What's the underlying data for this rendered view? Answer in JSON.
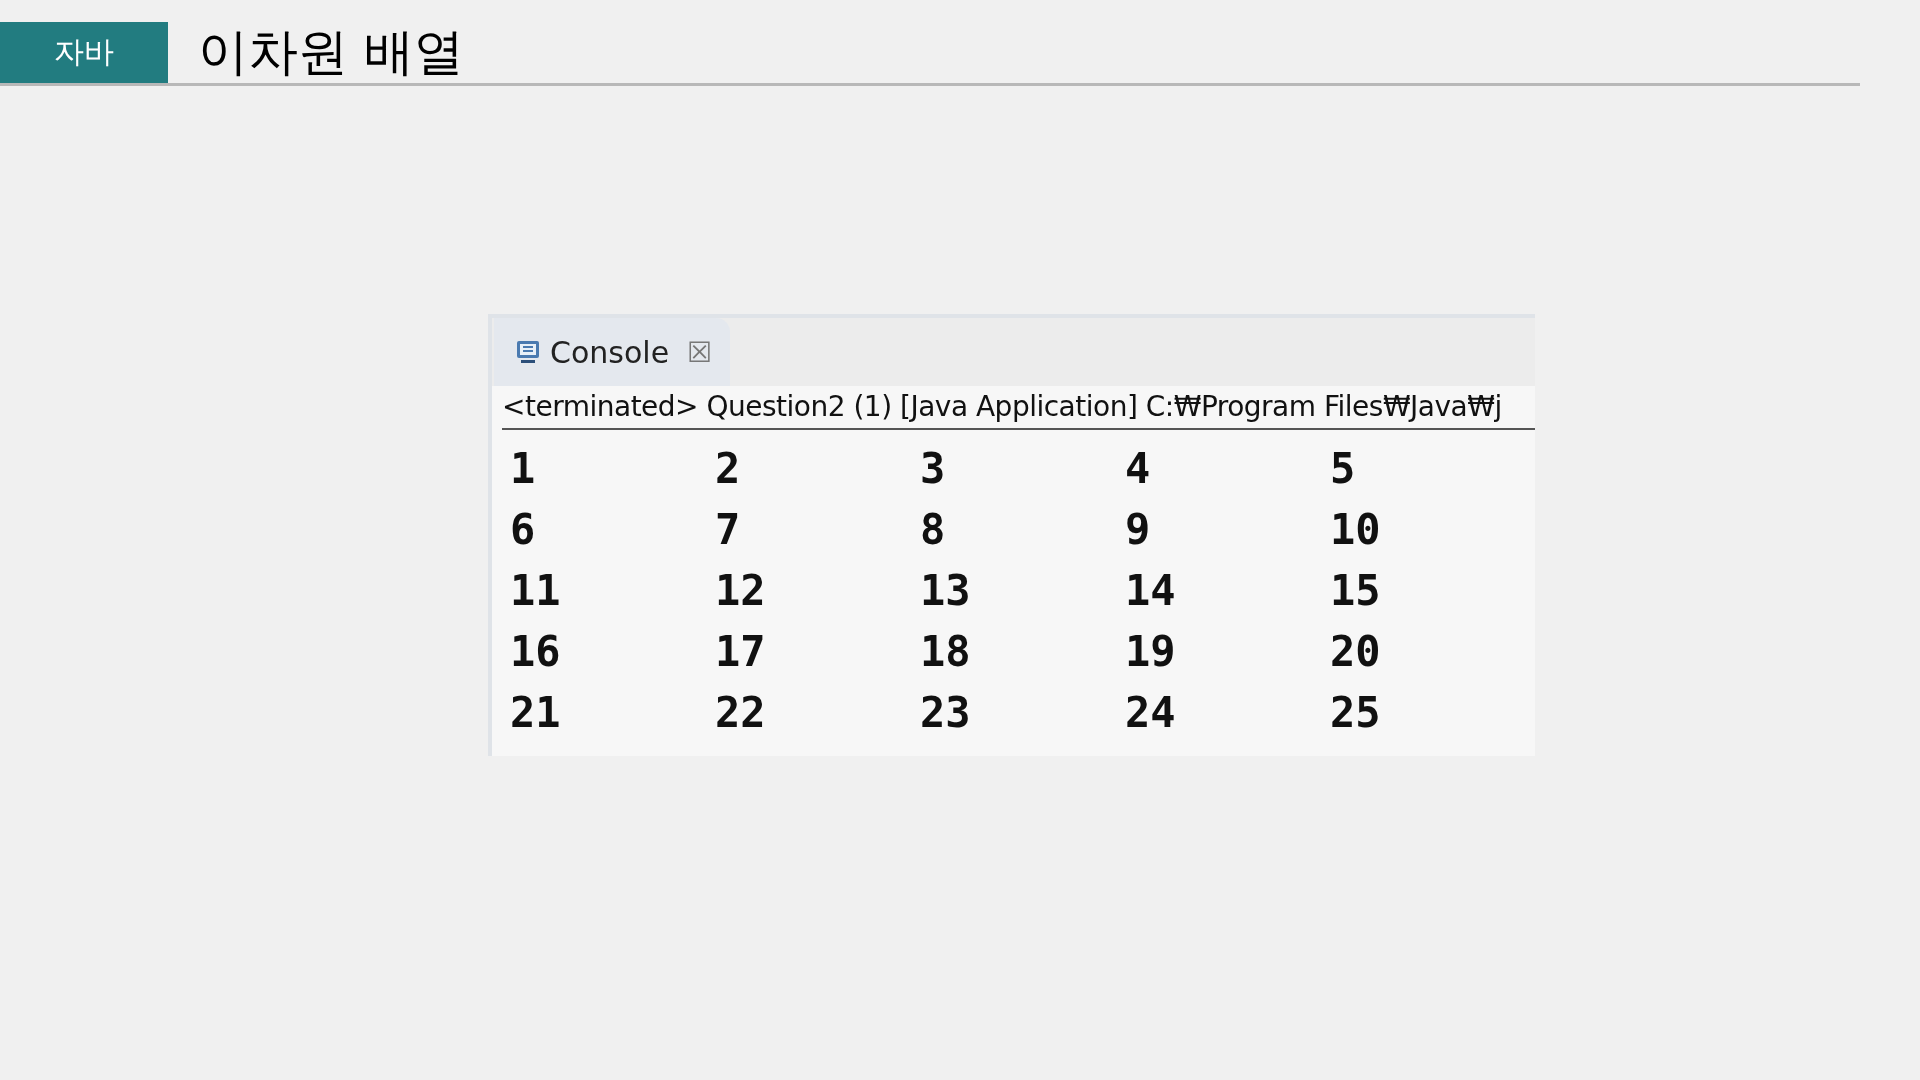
{
  "header": {
    "tag": "자바",
    "title": "이차원 배열"
  },
  "console": {
    "tab": {
      "label": "Console",
      "close": "☒"
    },
    "status": "<terminated> Question2 (1) [Java Application] C:₩Program Files₩Java₩j",
    "rows": [
      [
        "1",
        "2",
        "3",
        "4",
        "5"
      ],
      [
        "6",
        "7",
        "8",
        "9",
        "10"
      ],
      [
        "11",
        "12",
        "13",
        "14",
        "15"
      ],
      [
        "16",
        "17",
        "18",
        "19",
        "20"
      ],
      [
        "21",
        "22",
        "23",
        "24",
        "25"
      ]
    ]
  }
}
